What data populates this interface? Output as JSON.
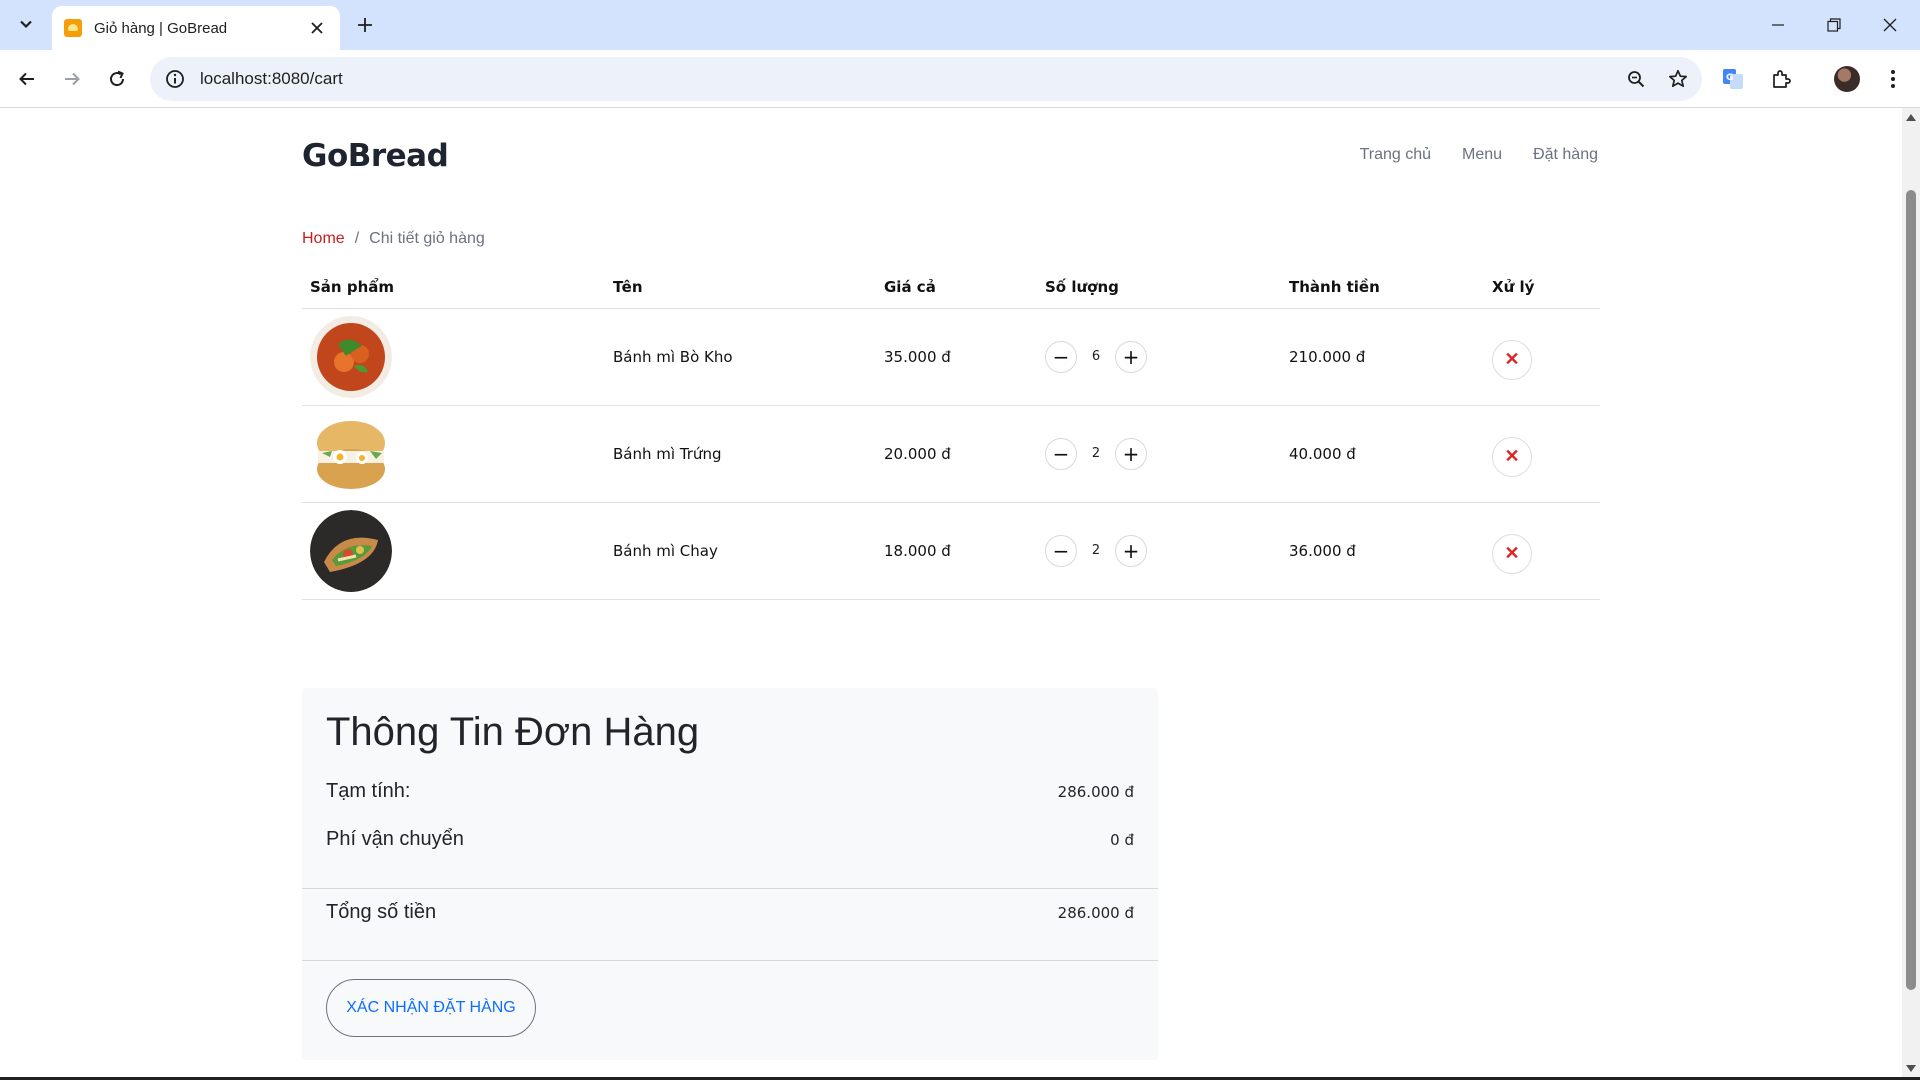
{
  "browser": {
    "tab_title": "Giỏ hàng | GoBread",
    "url": "localhost:8080/cart"
  },
  "site": {
    "brand": "GoBread",
    "nav": [
      {
        "label": "Trang chủ"
      },
      {
        "label": "Menu"
      },
      {
        "label": "Đặt hàng"
      }
    ]
  },
  "breadcrumb": {
    "home": "Home",
    "separator": "/",
    "current": "Chi tiết giỏ hàng"
  },
  "cart": {
    "headers": {
      "product": "Sản phẩm",
      "name": "Tên",
      "price": "Giá cả",
      "quantity": "Số lượng",
      "subtotal": "Thành tiền",
      "action": "Xử lý"
    },
    "items": [
      {
        "name": "Bánh mì Bò Kho",
        "price": "35.000 đ",
        "quantity": "6",
        "subtotal": "210.000 đ"
      },
      {
        "name": "Bánh mì Trứng",
        "price": "20.000 đ",
        "quantity": "2",
        "subtotal": "40.000 đ"
      },
      {
        "name": "Bánh mì Chay",
        "price": "18.000 đ",
        "quantity": "2",
        "subtotal": "36.000 đ"
      }
    ]
  },
  "summary": {
    "title": "Thông Tin Đơn Hàng",
    "subtotal_label": "Tạm tính:",
    "subtotal_value": "286.000 đ",
    "shipping_label": "Phí vận chuyển",
    "shipping_value": "0 đ",
    "total_label": "Tổng số tiền",
    "total_value": "286.000 đ",
    "confirm_label": "XÁC NHẬN ĐẶT HÀNG"
  },
  "colors": {
    "tabbar_bg": "#d3e3fd",
    "breadcrumb_link": "#c81e1e",
    "delete_icon": "#dc2626",
    "confirm_text": "#0d6efd"
  }
}
